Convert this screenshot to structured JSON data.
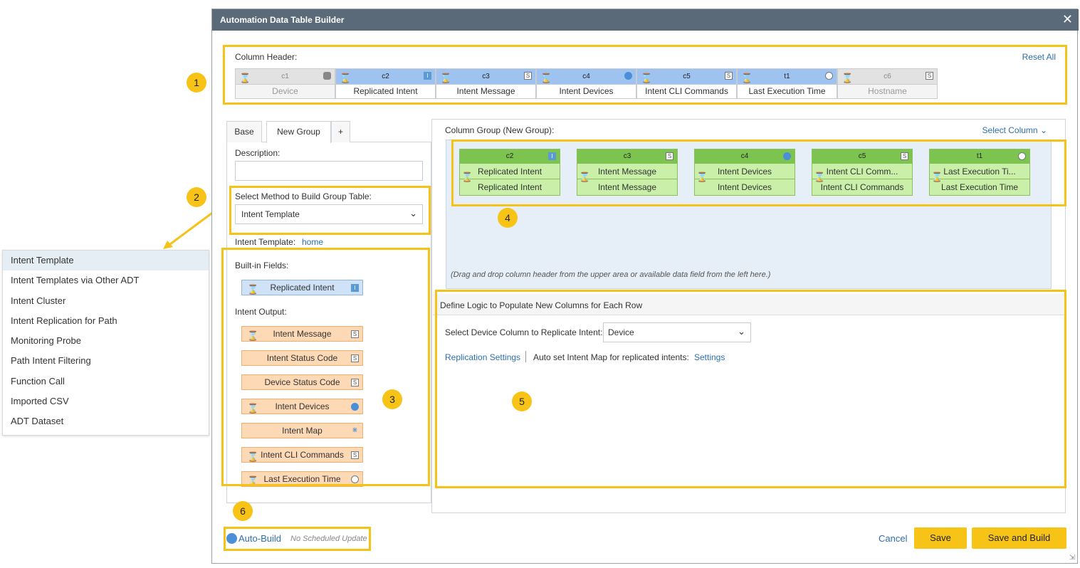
{
  "dropdown": {
    "options": [
      "Intent Template",
      "Intent Templates via Other ADT",
      "Intent Cluster",
      "Intent Replication for Path",
      "Monitoring Probe",
      "Path Intent Filtering",
      "Function Call",
      "Imported CSV",
      "ADT Dataset"
    ],
    "selected": "Intent Template"
  },
  "dialog": {
    "title": "Automation Data Table Builder",
    "close": "✕"
  },
  "column_header": {
    "label": "Column Header:",
    "reset_all": "Reset All",
    "columns": [
      {
        "id": "c1",
        "name": "Device",
        "state": "grey",
        "type": "db"
      },
      {
        "id": "c2",
        "name": "Replicated Intent",
        "state": "blue",
        "type": "I"
      },
      {
        "id": "c3",
        "name": "Intent Message",
        "state": "blue",
        "type": "S"
      },
      {
        "id": "c4",
        "name": "Intent Devices",
        "state": "blue",
        "type": "dev"
      },
      {
        "id": "c5",
        "name": "Intent CLI Commands",
        "state": "blue",
        "type": "S"
      },
      {
        "id": "t1",
        "name": "Last Execution Time",
        "state": "blue",
        "type": "clock"
      },
      {
        "id": "c6",
        "name": "Hostname",
        "state": "grey",
        "type": "S"
      }
    ]
  },
  "tabs": [
    "Base",
    "New Group",
    "+"
  ],
  "left_panel": {
    "description_label": "Description:",
    "description_value": "",
    "method_label": "Select Method to Build Group Table:",
    "method_value": "Intent Template",
    "template_label": "Intent Template:",
    "template_value": "home",
    "builtin_label": "Built-in Fields:",
    "builtin_fields": [
      {
        "name": "Replicated Intent",
        "type": "I",
        "link": true
      }
    ],
    "output_label": "Intent Output:",
    "output_fields": [
      {
        "name": "Intent Message",
        "type": "S",
        "link": true
      },
      {
        "name": "Intent Status Code",
        "type": "S",
        "link": false
      },
      {
        "name": "Device Status Code",
        "type": "S",
        "link": false
      },
      {
        "name": "Intent Devices",
        "type": "dev",
        "link": true
      },
      {
        "name": "Intent Map",
        "type": "map",
        "link": false
      },
      {
        "name": "Intent CLI Commands",
        "type": "S",
        "link": true
      },
      {
        "name": "Last Execution Time",
        "type": "clock",
        "link": true
      }
    ]
  },
  "column_group": {
    "label": "Column Group (New Group):",
    "select_column": "Select Column",
    "cards": [
      {
        "id": "c2",
        "top": "Replicated Intent",
        "bottom": "Replicated Intent",
        "type": "I"
      },
      {
        "id": "c3",
        "top": "Intent Message",
        "bottom": "Intent Message",
        "type": "S"
      },
      {
        "id": "c4",
        "top": "Intent Devices",
        "bottom": "Intent Devices",
        "type": "dev"
      },
      {
        "id": "c5",
        "top": "Intent CLI Comm...",
        "bottom": "Intent CLI Commands",
        "type": "S"
      },
      {
        "id": "t1",
        "top": "Last Execution Ti...",
        "bottom": "Last Execution Time",
        "type": "clock"
      }
    ],
    "hint": "(Drag and drop column header from the upper area or available data field from the left here.)"
  },
  "logic": {
    "title": "Define Logic to Populate New Columns for Each Row",
    "device_label": "Select Device Column to Replicate Intent:",
    "device_value": "Device",
    "replication_settings": "Replication Settings",
    "auto_set_label": "Auto set Intent Map for replicated intents:",
    "settings_link": "Settings"
  },
  "footer": {
    "auto_build": "Auto-Build",
    "schedule": "No Scheduled Update",
    "cancel": "Cancel",
    "save": "Save",
    "save_build": "Save and Build"
  },
  "badges": [
    "1",
    "2",
    "3",
    "4",
    "5",
    "6"
  ],
  "colors": {
    "highlight": "#f5c218",
    "title_bar": "#5a6a78",
    "accent_button": "#f7c316",
    "link": "#2f6fad"
  }
}
